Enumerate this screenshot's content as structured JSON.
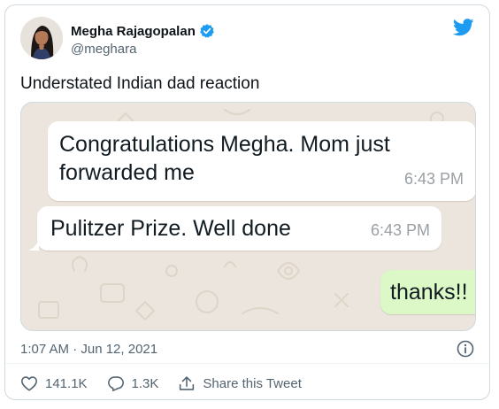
{
  "author": {
    "name": "Megha Rajagopalan",
    "handle": "@meghara"
  },
  "tweet": {
    "text": "Understated Indian dad reaction",
    "timestamp": "1:07 AM · Jun 12, 2021"
  },
  "chat": {
    "messages": [
      {
        "text": "Congratulations Megha. Mom just forwarded me",
        "time": "6:43 PM",
        "direction": "incoming"
      },
      {
        "text": "Pulitzer Prize. Well done",
        "time": "6:43 PM",
        "direction": "incoming"
      },
      {
        "text": "thanks!!",
        "direction": "outgoing"
      }
    ]
  },
  "actions": {
    "likes": "141.1K",
    "replies": "1.3K",
    "share_label": "Share this Tweet"
  },
  "colors": {
    "twitter_blue": "#1d9bf0",
    "chat_background": "#ece5dd",
    "outgoing_bubble": "#dcf8c6",
    "muted_text": "#536471"
  },
  "icons": [
    "verified-badge-icon",
    "twitter-bird-icon",
    "info-icon",
    "heart-icon",
    "reply-icon",
    "share-icon"
  ]
}
